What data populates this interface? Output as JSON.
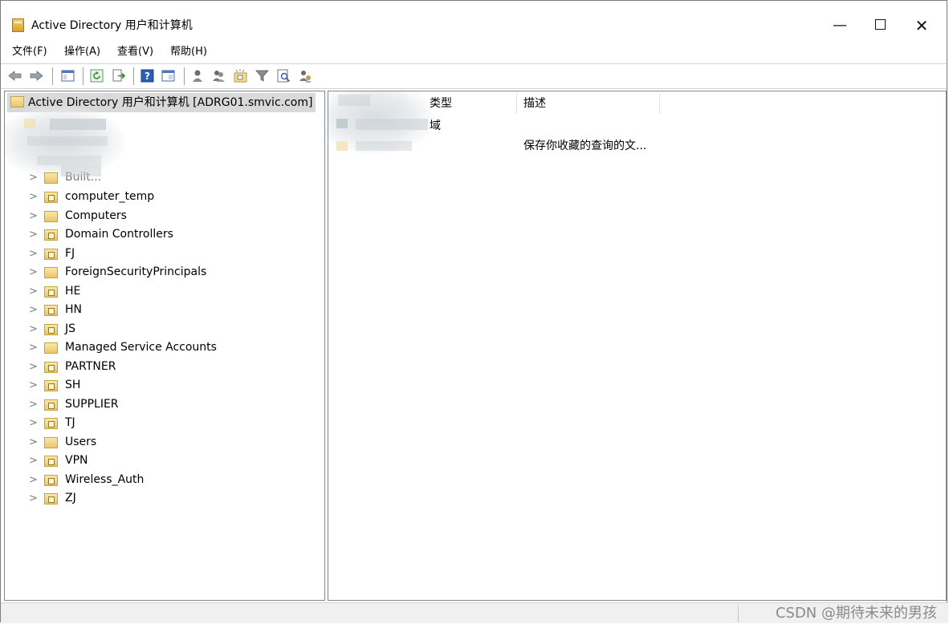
{
  "window": {
    "title": "Active Directory 用户和计算机",
    "controls": {
      "minimize": "—",
      "close": "✕"
    }
  },
  "menu": [
    "文件(F)",
    "操作(A)",
    "查看(V)",
    "帮助(H)"
  ],
  "toolbar": {
    "icons": [
      "back-icon",
      "forward-icon",
      "show-tree-icon",
      "refresh-icon",
      "export-icon",
      "help-icon",
      "action-pane-icon",
      "user-icon",
      "users-group-icon",
      "new-ou-icon",
      "filter-icon",
      "find-icon",
      "delegate-icon"
    ]
  },
  "tree": {
    "root": "Active Directory 用户和计算机 [ADRG01.smvic.com]",
    "partial_item": "Built...",
    "items": [
      {
        "label": "computer_temp",
        "type": "ou"
      },
      {
        "label": "Computers",
        "type": "container"
      },
      {
        "label": "Domain Controllers",
        "type": "ou"
      },
      {
        "label": "FJ",
        "type": "ou"
      },
      {
        "label": "ForeignSecurityPrincipals",
        "type": "container"
      },
      {
        "label": "HE",
        "type": "ou"
      },
      {
        "label": "HN",
        "type": "ou"
      },
      {
        "label": "JS",
        "type": "ou"
      },
      {
        "label": "Managed Service Accounts",
        "type": "container"
      },
      {
        "label": "PARTNER",
        "type": "ou"
      },
      {
        "label": "SH",
        "type": "ou"
      },
      {
        "label": "SUPPLIER",
        "type": "ou"
      },
      {
        "label": "TJ",
        "type": "ou"
      },
      {
        "label": "Users",
        "type": "container"
      },
      {
        "label": "VPN",
        "type": "ou"
      },
      {
        "label": "Wireless_Auth",
        "type": "ou"
      },
      {
        "label": "ZJ",
        "type": "ou"
      }
    ]
  },
  "list": {
    "columns": {
      "type": "类型",
      "description": "描述"
    },
    "rows": [
      {
        "type": "域",
        "description": ""
      },
      {
        "type": "",
        "description": "保存你收藏的查询的文..."
      }
    ]
  },
  "status": {
    "watermark": "CSDN @期待未来的男孩"
  }
}
